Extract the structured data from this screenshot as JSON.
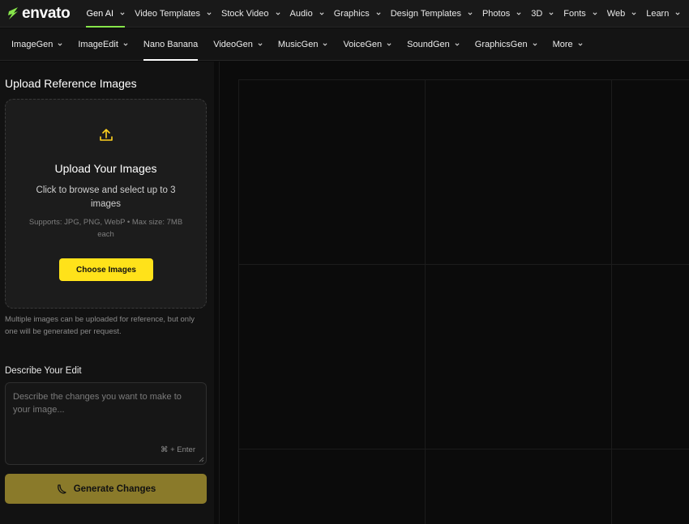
{
  "brand": {
    "name": "envato",
    "accent": "#87e64b"
  },
  "top_nav": [
    {
      "label": "Gen AI",
      "active": true
    },
    {
      "label": "Video Templates"
    },
    {
      "label": "Stock Video"
    },
    {
      "label": "Audio"
    },
    {
      "label": "Graphics"
    },
    {
      "label": "Design Templates"
    },
    {
      "label": "Photos"
    },
    {
      "label": "3D"
    },
    {
      "label": "Fonts"
    },
    {
      "label": "Web"
    },
    {
      "label": "Learn"
    }
  ],
  "sub_nav": [
    {
      "label": "ImageGen",
      "dropdown": true
    },
    {
      "label": "ImageEdit",
      "dropdown": true
    },
    {
      "label": "Nano Banana",
      "dropdown": false,
      "active": true
    },
    {
      "label": "VideoGen",
      "dropdown": true
    },
    {
      "label": "MusicGen",
      "dropdown": true
    },
    {
      "label": "VoiceGen",
      "dropdown": true
    },
    {
      "label": "SoundGen",
      "dropdown": true
    },
    {
      "label": "GraphicsGen",
      "dropdown": true
    },
    {
      "label": "More",
      "dropdown": true
    }
  ],
  "upload": {
    "section_title": "Upload Reference Images",
    "title": "Upload Your Images",
    "subtitle": "Click to browse and select up to 3 images",
    "supports": "Supports: JPG, PNG, WebP • Max size: 7MB each",
    "button_label": "Choose Images",
    "note": "Multiple images can be uploaded for reference, but only one will be generated per request.",
    "icon": "upload-icon",
    "icon_color": "#ffd21f"
  },
  "describe": {
    "title": "Describe Your Edit",
    "placeholder": "Describe the changes you want to make to your image...",
    "shortcut": "⌘ + Enter"
  },
  "generate": {
    "label": "Generate Changes",
    "icon": "banana-icon",
    "color": "#8a7a2a"
  },
  "colors": {
    "button_yellow": "#ffe21a",
    "panel_bg": "#121212",
    "canvas_bg": "#0b0b0b"
  }
}
